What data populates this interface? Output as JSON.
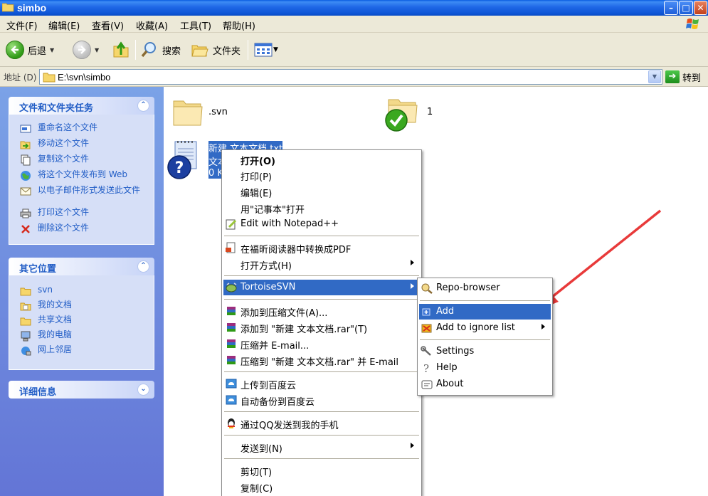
{
  "window": {
    "title": "simbo"
  },
  "menubar": {
    "items": [
      "文件(F)",
      "编辑(E)",
      "查看(V)",
      "收藏(A)",
      "工具(T)",
      "帮助(H)"
    ]
  },
  "toolbar": {
    "back_label": "后退",
    "search_label": "搜索",
    "folders_label": "文件夹"
  },
  "address": {
    "label": "地址 (D)",
    "value": "E:\\svn\\simbo",
    "go_label": "转到"
  },
  "tasks_panel": {
    "title": "文件和文件夹任务",
    "items": [
      "重命名这个文件",
      "移动这个文件",
      "复制这个文件",
      "将这个文件发布到 Web",
      "以电子邮件形式发送此文件",
      "打印这个文件",
      "删除这个文件"
    ]
  },
  "places_panel": {
    "title": "其它位置",
    "items": [
      "svn",
      "我的文档",
      "共享文档",
      "我的电脑",
      "网上邻居"
    ]
  },
  "details_panel": {
    "title": "详细信息"
  },
  "files": [
    {
      "name": ".svn"
    },
    {
      "name": "1"
    },
    {
      "name": "新建 文本文档.txt",
      "line2": "文本",
      "line3": "0 K"
    }
  ],
  "context_menu": {
    "items": [
      "打开(O)",
      "打印(P)",
      "编辑(E)",
      "用\"记事本\"打开",
      "Edit with Notepad++",
      "在福昕阅读器中转换成PDF",
      "打开方式(H)",
      "TortoiseSVN",
      "添加到压缩文件(A)...",
      "添加到 \"新建 文本文档.rar\"(T)",
      "压缩并 E-mail...",
      "压缩到 \"新建 文本文档.rar\" 并 E-mail",
      "上传到百度云",
      "自动备份到百度云",
      "通过QQ发送到我的手机",
      "发送到(N)",
      "剪切(T)",
      "复制(C)"
    ]
  },
  "svn_submenu": {
    "items": [
      "Repo-browser",
      "Add",
      "Add to ignore list",
      "Settings",
      "Help",
      "About"
    ]
  },
  "colors": {
    "highlight": "#316ac5",
    "annotation_arrow": "#e83a3a"
  }
}
